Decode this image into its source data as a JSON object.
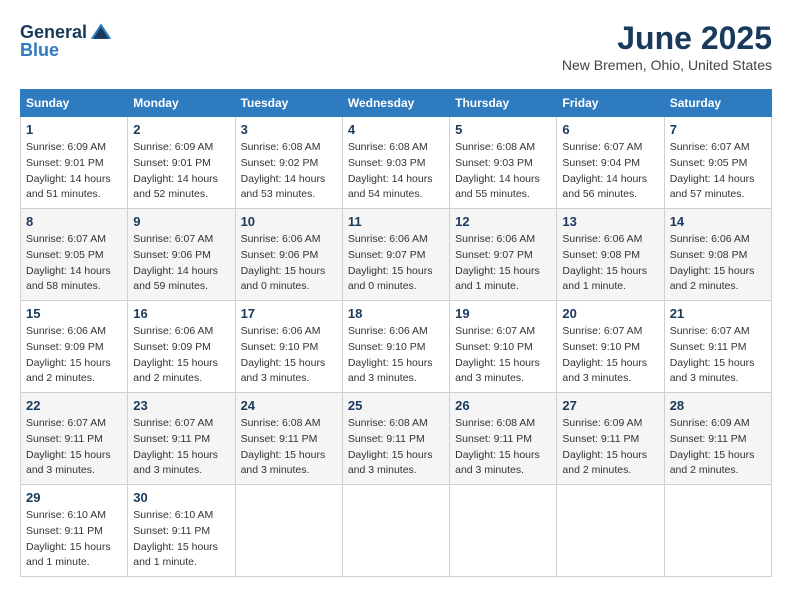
{
  "header": {
    "logo_general": "General",
    "logo_blue": "Blue",
    "title": "June 2025",
    "location": "New Bremen, Ohio, United States"
  },
  "calendar": {
    "days_of_week": [
      "Sunday",
      "Monday",
      "Tuesday",
      "Wednesday",
      "Thursday",
      "Friday",
      "Saturday"
    ],
    "weeks": [
      [
        {
          "day": "",
          "info": ""
        },
        {
          "day": "2",
          "info": "Sunrise: 6:09 AM\nSunset: 9:01 PM\nDaylight: 14 hours\nand 52 minutes."
        },
        {
          "day": "3",
          "info": "Sunrise: 6:08 AM\nSunset: 9:02 PM\nDaylight: 14 hours\nand 53 minutes."
        },
        {
          "day": "4",
          "info": "Sunrise: 6:08 AM\nSunset: 9:03 PM\nDaylight: 14 hours\nand 54 minutes."
        },
        {
          "day": "5",
          "info": "Sunrise: 6:08 AM\nSunset: 9:03 PM\nDaylight: 14 hours\nand 55 minutes."
        },
        {
          "day": "6",
          "info": "Sunrise: 6:07 AM\nSunset: 9:04 PM\nDaylight: 14 hours\nand 56 minutes."
        },
        {
          "day": "7",
          "info": "Sunrise: 6:07 AM\nSunset: 9:05 PM\nDaylight: 14 hours\nand 57 minutes."
        }
      ],
      [
        {
          "day": "1",
          "info": "Sunrise: 6:09 AM\nSunset: 9:01 PM\nDaylight: 14 hours\nand 51 minutes."
        },
        {
          "day": "8",
          "info": "Sunrise: 6:07 AM\nSunset: 9:05 PM\nDaylight: 14 hours\nand 58 minutes."
        },
        {
          "day": "9",
          "info": "Sunrise: 6:07 AM\nSunset: 9:06 PM\nDaylight: 14 hours\nand 59 minutes."
        },
        {
          "day": "10",
          "info": "Sunrise: 6:06 AM\nSunset: 9:06 PM\nDaylight: 15 hours\nand 0 minutes."
        },
        {
          "day": "11",
          "info": "Sunrise: 6:06 AM\nSunset: 9:07 PM\nDaylight: 15 hours\nand 0 minutes."
        },
        {
          "day": "12",
          "info": "Sunrise: 6:06 AM\nSunset: 9:07 PM\nDaylight: 15 hours\nand 1 minute."
        },
        {
          "day": "13",
          "info": "Sunrise: 6:06 AM\nSunset: 9:08 PM\nDaylight: 15 hours\nand 1 minute."
        }
      ],
      [
        {
          "day": "14",
          "info": "Sunrise: 6:06 AM\nSunset: 9:08 PM\nDaylight: 15 hours\nand 2 minutes."
        },
        {
          "day": "15",
          "info": "Sunrise: 6:06 AM\nSunset: 9:09 PM\nDaylight: 15 hours\nand 2 minutes."
        },
        {
          "day": "16",
          "info": "Sunrise: 6:06 AM\nSunset: 9:09 PM\nDaylight: 15 hours\nand 2 minutes."
        },
        {
          "day": "17",
          "info": "Sunrise: 6:06 AM\nSunset: 9:10 PM\nDaylight: 15 hours\nand 3 minutes."
        },
        {
          "day": "18",
          "info": "Sunrise: 6:06 AM\nSunset: 9:10 PM\nDaylight: 15 hours\nand 3 minutes."
        },
        {
          "day": "19",
          "info": "Sunrise: 6:07 AM\nSunset: 9:10 PM\nDaylight: 15 hours\nand 3 minutes."
        },
        {
          "day": "20",
          "info": "Sunrise: 6:07 AM\nSunset: 9:10 PM\nDaylight: 15 hours\nand 3 minutes."
        }
      ],
      [
        {
          "day": "21",
          "info": "Sunrise: 6:07 AM\nSunset: 9:11 PM\nDaylight: 15 hours\nand 3 minutes."
        },
        {
          "day": "22",
          "info": "Sunrise: 6:07 AM\nSunset: 9:11 PM\nDaylight: 15 hours\nand 3 minutes."
        },
        {
          "day": "23",
          "info": "Sunrise: 6:07 AM\nSunset: 9:11 PM\nDaylight: 15 hours\nand 3 minutes."
        },
        {
          "day": "24",
          "info": "Sunrise: 6:08 AM\nSunset: 9:11 PM\nDaylight: 15 hours\nand 3 minutes."
        },
        {
          "day": "25",
          "info": "Sunrise: 6:08 AM\nSunset: 9:11 PM\nDaylight: 15 hours\nand 3 minutes."
        },
        {
          "day": "26",
          "info": "Sunrise: 6:08 AM\nSunset: 9:11 PM\nDaylight: 15 hours\nand 3 minutes."
        },
        {
          "day": "27",
          "info": "Sunrise: 6:09 AM\nSunset: 9:11 PM\nDaylight: 15 hours\nand 2 minutes."
        }
      ],
      [
        {
          "day": "28",
          "info": "Sunrise: 6:09 AM\nSunset: 9:11 PM\nDaylight: 15 hours\nand 2 minutes."
        },
        {
          "day": "29",
          "info": "Sunrise: 6:10 AM\nSunset: 9:11 PM\nDaylight: 15 hours\nand 1 minute."
        },
        {
          "day": "30",
          "info": "Sunrise: 6:10 AM\nSunset: 9:11 PM\nDaylight: 15 hours\nand 1 minute."
        },
        {
          "day": "",
          "info": ""
        },
        {
          "day": "",
          "info": ""
        },
        {
          "day": "",
          "info": ""
        },
        {
          "day": "",
          "info": ""
        }
      ]
    ]
  }
}
